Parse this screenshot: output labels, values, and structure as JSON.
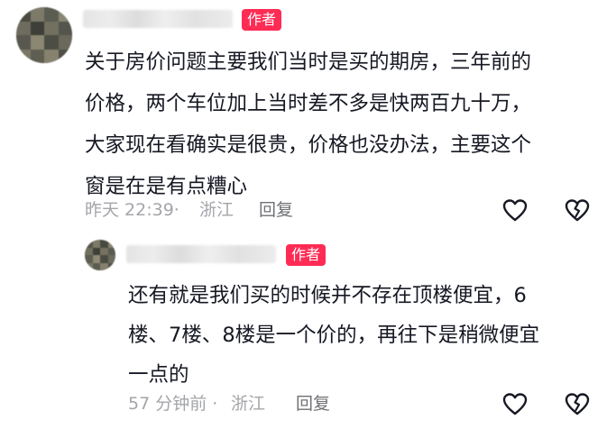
{
  "comments": [
    {
      "badge": "作者",
      "lines": [
        "关于房价问题主要我们当时是买的期房，三年前的",
        "价格，两个车位加上当时差不多是快两百九十万，",
        "大家现在看确实是很贵，价格也没办法，主要这个",
        "窗是在是有点糟心"
      ],
      "time": "昨天 22:39·",
      "location": "浙江",
      "reply": "回复",
      "like_icon": "heart-outline-icon",
      "dislike_icon": "broken-heart-icon"
    },
    {
      "badge": "作者",
      "lines": [
        "还有就是我们买的时候并不存在顶楼便宜，6",
        "楼、7楼、8楼是一个价的，再往下是稍微便宜",
        "一点的"
      ],
      "time": "57 分钟前 ·",
      "location": "浙江",
      "reply": "回复",
      "like_icon": "heart-outline-icon",
      "dislike_icon": "broken-heart-icon"
    }
  ],
  "colors": {
    "badge": "#fe2c55",
    "text": "#161823",
    "meta": "#a4a5aa",
    "reply": "#6f7075"
  }
}
